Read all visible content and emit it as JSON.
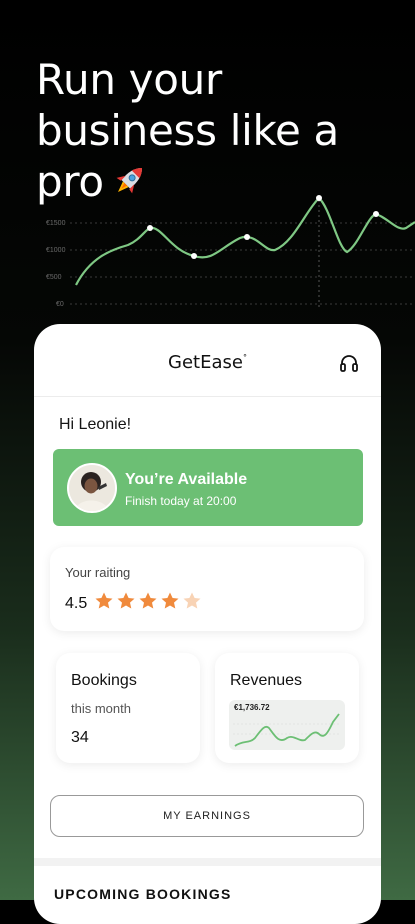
{
  "headline": {
    "line1": "Run your",
    "line2": "business like a",
    "line3": "pro",
    "emoji": "rocket-emoji"
  },
  "bg_chart": {
    "y_ticks": [
      "€1500",
      "€1000",
      "€500",
      "€0"
    ],
    "accent_color": "#7fc884"
  },
  "app": {
    "logo": "GetEase",
    "logo_mark": "°",
    "support_icon": "headset-icon",
    "greeting": "Hi Leonie!",
    "availability": {
      "title": "You’re Available",
      "subtitle": "Finish today at 20:00",
      "color": "#6cbf74"
    },
    "rating": {
      "label": "Your raiting",
      "value": "4.5",
      "stars": 4.5,
      "star_color": "#f08a3c"
    },
    "bookings": {
      "title": "Bookings",
      "subtitle": "this month",
      "count": "34"
    },
    "revenues": {
      "title": "Revenues",
      "amount": "€1,736.72"
    },
    "earnings_button": "MY EARNINGS",
    "upcoming_title": "UPCOMING BOOKINGS"
  }
}
